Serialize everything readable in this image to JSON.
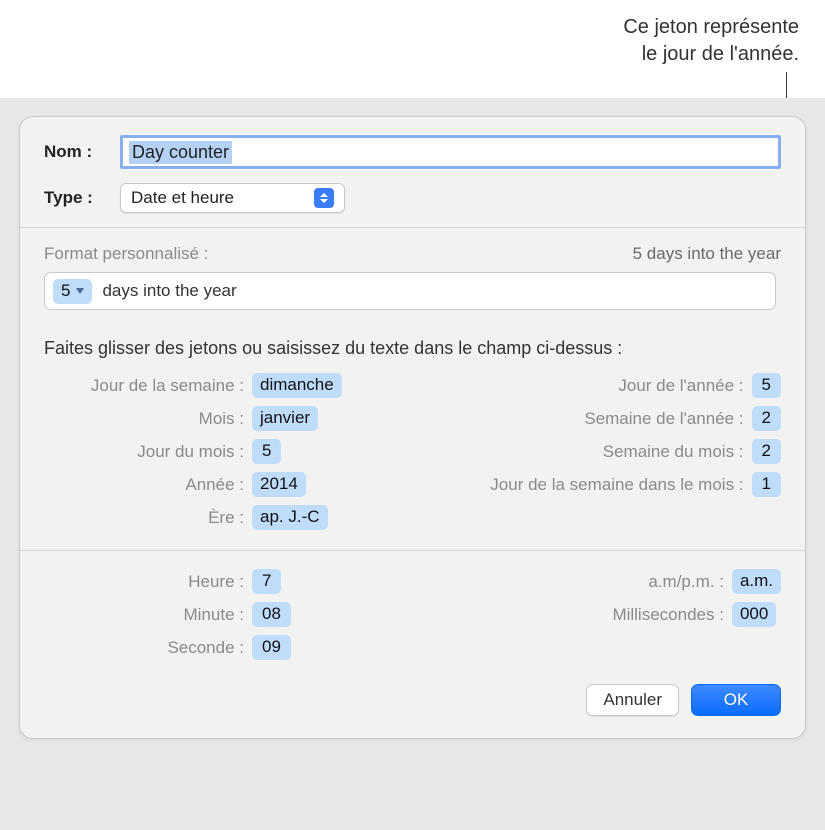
{
  "callout": {
    "line1": "Ce jeton représente",
    "line2": "le jour de l'année."
  },
  "dialog": {
    "name_label": "Nom :",
    "name_value": "Day counter",
    "type_label": "Type :",
    "type_value": "Date et heure",
    "format_label": "Format personnalisé :",
    "format_preview": "5 days into the year",
    "format_field": {
      "token": "5",
      "suffix": "days into the year"
    },
    "instructions": "Faites glisser des jetons ou saisissez du texte dans le champ ci-dessus :",
    "date_tokens": {
      "left": [
        {
          "label": "Jour de la semaine :",
          "value": "dimanche"
        },
        {
          "label": "Mois :",
          "value": "janvier"
        },
        {
          "label": "Jour du mois :",
          "value": "5"
        },
        {
          "label": "Année :",
          "value": "2014"
        },
        {
          "label": "Ère :",
          "value": "ap. J.-C"
        }
      ],
      "right": [
        {
          "label": "Jour de l'année :",
          "value": "5"
        },
        {
          "label": "Semaine de l'année :",
          "value": "2"
        },
        {
          "label": "Semaine du mois :",
          "value": "2"
        },
        {
          "label": "Jour de la semaine dans le mois :",
          "value": "1"
        }
      ]
    },
    "time_tokens": {
      "left": [
        {
          "label": "Heure :",
          "value": "7"
        },
        {
          "label": "Minute :",
          "value": "08"
        },
        {
          "label": "Seconde :",
          "value": "09"
        }
      ],
      "right": [
        {
          "label": "a.m/p.m. :",
          "value": "a.m."
        },
        {
          "label": "Millisecondes :",
          "value": "000"
        }
      ]
    },
    "buttons": {
      "cancel": "Annuler",
      "ok": "OK"
    }
  }
}
